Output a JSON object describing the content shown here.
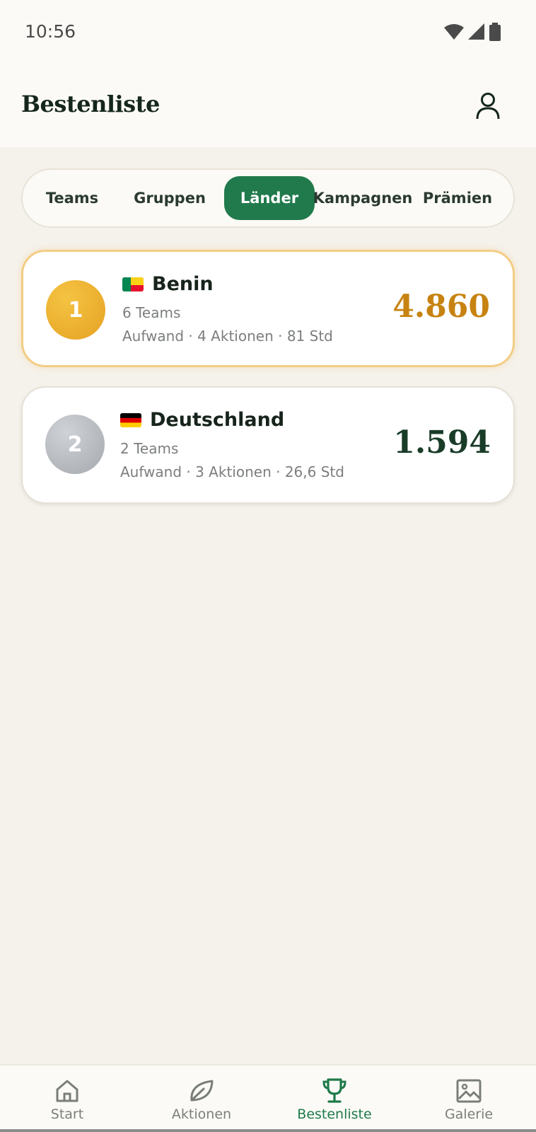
{
  "status_bar": {
    "time": "10:56"
  },
  "header": {
    "title": "Bestenliste"
  },
  "tabs": [
    {
      "label": "Teams",
      "active": false
    },
    {
      "label": "Gruppen",
      "active": false
    },
    {
      "label": "Länder",
      "active": true
    },
    {
      "label": "Kampagnen",
      "active": false
    },
    {
      "label": "Prämien",
      "active": false
    }
  ],
  "leaderboard": [
    {
      "rank": "1",
      "country": "Benin",
      "flag": "benin-flag-icon",
      "teams": "6 Teams",
      "effort": "Aufwand · 4 Aktionen · 81 Std",
      "score": "4.860"
    },
    {
      "rank": "2",
      "country": "Deutschland",
      "flag": "germany-flag-icon",
      "teams": "2 Teams",
      "effort": "Aufwand · 3 Aktionen · 26,6 Std",
      "score": "1.594"
    }
  ],
  "bottom_nav": [
    {
      "label": "Start",
      "icon": "home-icon",
      "active": false
    },
    {
      "label": "Aktionen",
      "icon": "leaf-icon",
      "active": false
    },
    {
      "label": "Bestenliste",
      "icon": "trophy-icon",
      "active": true
    },
    {
      "label": "Galerie",
      "icon": "image-icon",
      "active": false
    }
  ],
  "colors": {
    "accent": "#217a4c",
    "gold": "#c78312",
    "background": "#f5f2ec"
  }
}
